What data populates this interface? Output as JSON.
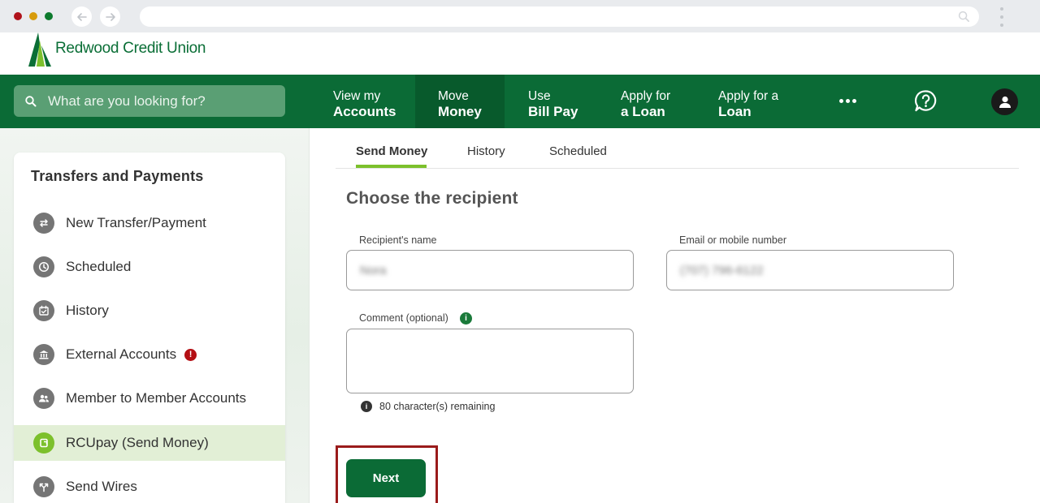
{
  "brand": {
    "name": "Redwood Credit Union",
    "primary_color": "#0b6b36",
    "accent_color": "#7cc02c"
  },
  "header": {
    "search_placeholder": "What are you looking for?",
    "nav": [
      {
        "line1": "View my",
        "line2": "Accounts"
      },
      {
        "line1": "Move",
        "line2": "Money",
        "active": true
      },
      {
        "line1": "Use",
        "line2": "Bill Pay"
      },
      {
        "line1": "Apply for",
        "line2": "a Loan"
      },
      {
        "line1": "Apply for a",
        "line2": "Loan"
      }
    ]
  },
  "sidebar": {
    "title": "Transfers and Payments",
    "items": [
      {
        "label": "New Transfer/Payment",
        "icon": "transfer-arrows-icon"
      },
      {
        "label": "Scheduled",
        "icon": "clock-icon"
      },
      {
        "label": "History",
        "icon": "calendar-check-icon"
      },
      {
        "label": "External Accounts",
        "icon": "bank-icon",
        "alert": "!"
      },
      {
        "label": "Member to Member Accounts",
        "icon": "people-icon"
      },
      {
        "label": "RCUpay (Send Money)",
        "icon": "rcupay-icon",
        "active": true
      },
      {
        "label": "Send Wires",
        "icon": "wire-split-icon"
      }
    ]
  },
  "tabs": [
    {
      "label": "Send Money",
      "active": true
    },
    {
      "label": "History"
    },
    {
      "label": "Scheduled"
    }
  ],
  "form": {
    "title": "Choose the recipient",
    "recipient_label": "Recipient's name",
    "recipient_value": "Nora",
    "contact_label": "Email or mobile number",
    "contact_value": "(707) 796-6122",
    "comment_label": "Comment (optional)",
    "comment_value": "",
    "remaining_text": "80 character(s) remaining",
    "next_label": "Next"
  }
}
